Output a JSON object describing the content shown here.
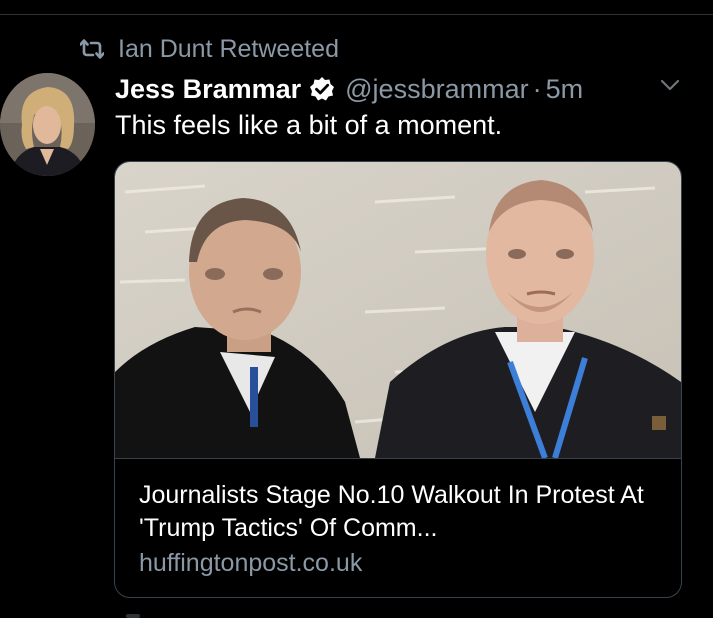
{
  "retweet": {
    "label": "Ian Dunt Retweeted",
    "icon": "retweet-icon"
  },
  "tweet": {
    "author_name": "Jess Brammar",
    "verified_icon": "verified-badge-icon",
    "handle": "@jessbrammar",
    "separator": "·",
    "time": "5m",
    "menu_icon": "chevron-down-icon",
    "text": "This feels like a bit of a moment."
  },
  "card": {
    "title": "Journalists Stage No.10 Walkout In Protest At 'Trump Tactics' Of Comm...",
    "domain": "huffingtonpost.co.uk"
  },
  "colors": {
    "background": "#000000",
    "primary_text": "#ffffff",
    "secondary_text": "#8b98a5",
    "border": "#38444d"
  }
}
